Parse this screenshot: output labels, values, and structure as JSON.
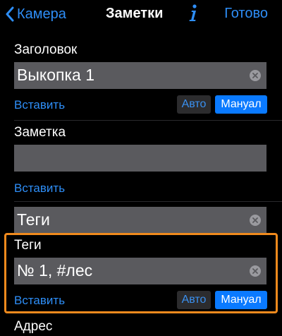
{
  "nav": {
    "back_label": "Камера",
    "title": "Заметки",
    "done_label": "Готово"
  },
  "accent_color": "#0a7aff",
  "highlight_color": "#f08a1d",
  "title_section": {
    "label": "Заголовок",
    "value": "Выкопка 1",
    "insert_label": "Вставить",
    "auto_label": "Авто",
    "manual_label": "Мануал"
  },
  "note_section": {
    "label": "Заметка",
    "value": "",
    "insert_label": "Вставить"
  },
  "tags_input": {
    "value": "Теги"
  },
  "tags_section": {
    "label": "Теги",
    "value": "№ 1, #лес",
    "insert_label": "Вставить",
    "auto_label": "Авто",
    "manual_label": "Мануал"
  },
  "address_section": {
    "label": "Адрес"
  }
}
